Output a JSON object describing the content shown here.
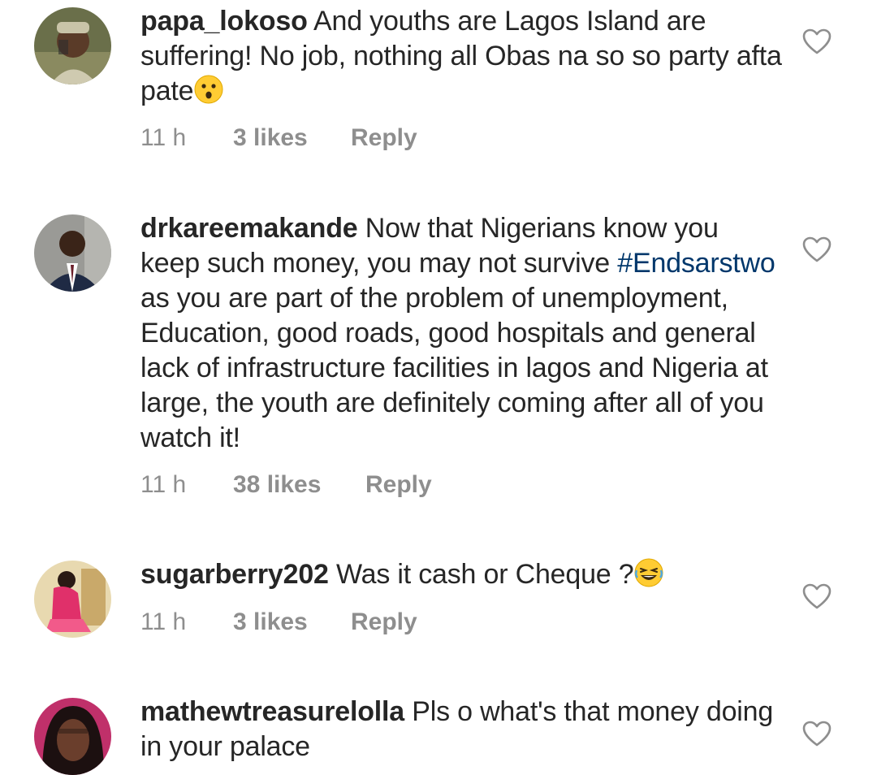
{
  "comments": [
    {
      "username": "papa_lokoso",
      "text_before": " And youths are Lagos Island are suffering! No job, nothing all Obas na so so party afta pate",
      "hashtag": "",
      "text_after": "",
      "emoji": "hushed-face-emoji",
      "time": "11 h",
      "likes": "3 likes",
      "reply": "Reply"
    },
    {
      "username": "drkareemakande",
      "text_before": " Now that Nigerians know you keep such money, you may not survive ",
      "hashtag": "#Endsarstwo",
      "text_after": " as you are part of the problem of unemployment, Education, good roads, good hospitals and general lack of infrastructure facilities in lagos and Nigeria at large, the youth are definitely coming after all of you watch it!",
      "emoji": "",
      "time": "11 h",
      "likes": "38 likes",
      "reply": "Reply"
    },
    {
      "username": "sugarberry202",
      "text_before": " Was it cash or Cheque ?",
      "hashtag": "",
      "text_after": "",
      "emoji": "laughing-face-emoji",
      "time": "11 h",
      "likes": "3 likes",
      "reply": "Reply"
    },
    {
      "username": "mathewtreasurelolla",
      "text_before": " Pls o what's that money doing in your palace",
      "hashtag": "",
      "text_after": "",
      "emoji": "",
      "time": "",
      "likes": "",
      "reply": ""
    }
  ],
  "colors": {
    "text": "#262626",
    "meta": "#8e8e8e",
    "hashtag": "#00376b",
    "heart_outline": "#8e8e8e"
  }
}
